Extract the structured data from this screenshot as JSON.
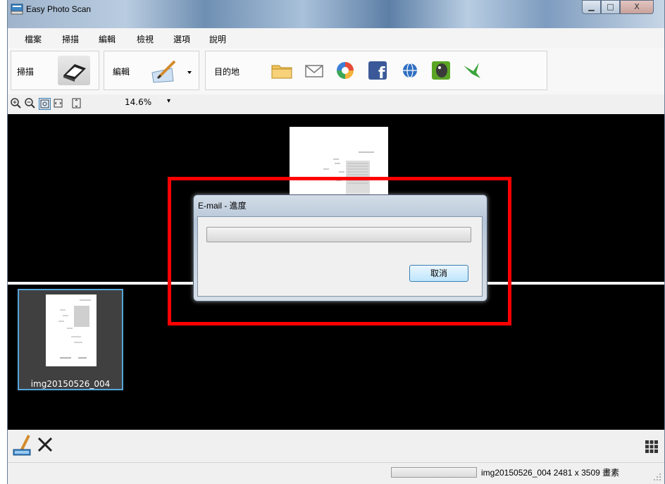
{
  "window": {
    "title": "Easy Photo Scan"
  },
  "menu": [
    "檔案",
    "掃描",
    "編輯",
    "檢視",
    "選項",
    "說明"
  ],
  "toolbar": {
    "scan_label": "掃描",
    "edit_label": "編輯",
    "destination_label": "目的地",
    "destinations": [
      "folder-icon",
      "mail-icon",
      "picasa-icon",
      "facebook-icon",
      "web-icon",
      "evernote-icon",
      "hummingbird-icon"
    ]
  },
  "zoom": {
    "value": "14.6%"
  },
  "thumbnail": {
    "name": "img20150526_004"
  },
  "dialog": {
    "title": "E-mail - 進度",
    "cancel_label": "取消",
    "progress": 0
  },
  "status": {
    "text": "img20150526_004 2481 x 3509 畫素"
  },
  "colors": {
    "accent": "#56a6db",
    "highlight": "#ff0000",
    "canvas": "#000000"
  }
}
